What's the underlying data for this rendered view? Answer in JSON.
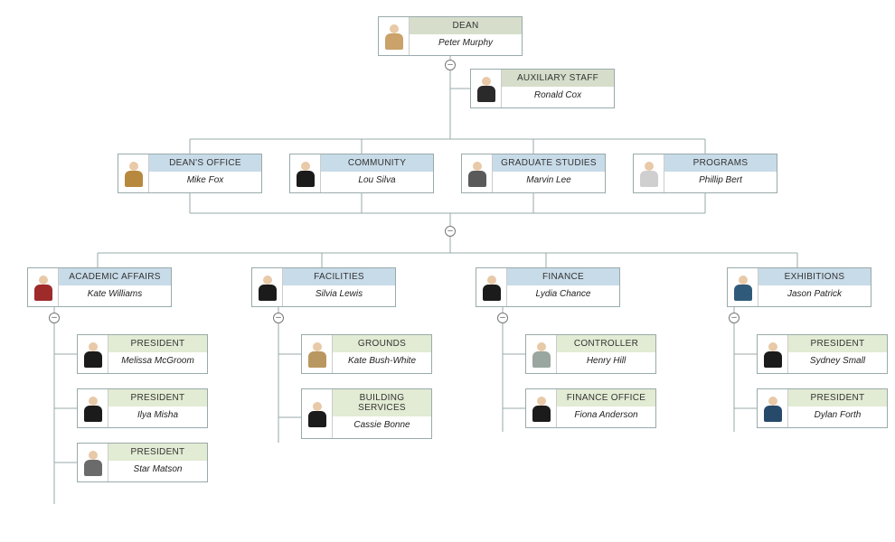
{
  "org": {
    "dean": {
      "title": "DEAN",
      "name": "Peter Murphy",
      "titleColor": "olive",
      "suit": "#caa26a"
    },
    "aux": {
      "title": "AUXILIARY STAFF",
      "name": "Ronald Cox",
      "titleColor": "olive",
      "suit": "#2a2a2a"
    },
    "deans_office": {
      "title": "DEAN'S OFFICE",
      "name": "Mike Fox",
      "titleColor": "blue",
      "suit": "#b7893f"
    },
    "community": {
      "title": "COMMUNITY",
      "name": "Lou Silva",
      "titleColor": "blue",
      "suit": "#1b1b1b"
    },
    "grad": {
      "title": "GRADUATE STUDIES",
      "name": "Marvin Lee",
      "titleColor": "blue",
      "suit": "#5a5a5a"
    },
    "programs": {
      "title": "PROGRAMS",
      "name": "Phillip Bert",
      "titleColor": "blue",
      "suit": "#cfcfcf"
    },
    "academic": {
      "title": "ACADEMIC AFFAIRS",
      "name": "Kate Williams",
      "titleColor": "blue",
      "suit": "#9e2a2a"
    },
    "facilities": {
      "title": "FACILITIES",
      "name": "Silvia Lewis",
      "titleColor": "blue",
      "suit": "#1b1b1b"
    },
    "finance": {
      "title": "FINANCE",
      "name": "Lydia Chance",
      "titleColor": "blue",
      "suit": "#1b1b1b"
    },
    "exhibitions": {
      "title": "EXHIBITIONS",
      "name": "Jason Patrick",
      "titleColor": "blue",
      "suit": "#305a7a"
    },
    "pres1": {
      "title": "PRESIDENT",
      "name": "Melissa McGroom",
      "titleColor": "green",
      "suit": "#1b1b1b"
    },
    "pres2": {
      "title": "PRESIDENT",
      "name": "Ilya Misha",
      "titleColor": "green",
      "suit": "#1b1b1b"
    },
    "pres3": {
      "title": "PRESIDENT",
      "name": "Star Matson",
      "titleColor": "green",
      "suit": "#6b6b6b"
    },
    "grounds": {
      "title": "GROUNDS",
      "name": "Kate Bush-White",
      "titleColor": "green",
      "suit": "#b99760"
    },
    "building": {
      "title": "BUILDING SERVICES",
      "name": "Cassie Bonne",
      "titleColor": "green",
      "suit": "#1b1b1b"
    },
    "controller": {
      "title": "CONTROLLER",
      "name": "Henry Hill",
      "titleColor": "green",
      "suit": "#9aa6a0"
    },
    "finoffice": {
      "title": "FINANCE OFFICE",
      "name": "Fiona Anderson",
      "titleColor": "green",
      "suit": "#1b1b1b"
    },
    "pres4": {
      "title": "PRESIDENT",
      "name": "Sydney Small",
      "titleColor": "green",
      "suit": "#1b1b1b"
    },
    "pres5": {
      "title": "PRESIDENT",
      "name": "Dylan Forth",
      "titleColor": "green",
      "suit": "#274a6b"
    }
  },
  "toggleGlyph": "–"
}
